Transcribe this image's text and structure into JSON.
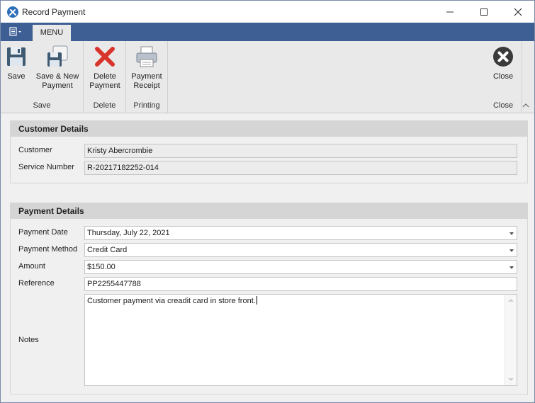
{
  "window": {
    "title": "Record Payment"
  },
  "tabs": {
    "menu": "MENU"
  },
  "ribbon": {
    "save_group": {
      "label": "Save",
      "save": "Save",
      "save_new_line1": "Save & New",
      "save_new_line2": "Payment"
    },
    "delete_group": {
      "label": "Delete",
      "delete_line1": "Delete",
      "delete_line2": "Payment"
    },
    "printing_group": {
      "label": "Printing",
      "receipt_line1": "Payment",
      "receipt_line2": "Receipt"
    },
    "close_group": {
      "label": "Close",
      "close": "Close"
    }
  },
  "customer_details": {
    "title": "Customer Details",
    "customer_label": "Customer",
    "customer_value": "Kristy Abercrombie",
    "service_label": "Service Number",
    "service_value": "R-20217182252-014"
  },
  "payment_details": {
    "title": "Payment Details",
    "date_label": "Payment Date",
    "date_value": "Thursday, July 22, 2021",
    "method_label": "Payment Method",
    "method_value": "Credit Card",
    "amount_label": "Amount",
    "amount_value": "$150.00",
    "reference_label": "Reference",
    "reference_value": "PP2255447788",
    "notes_label": "Notes",
    "notes_value": "Customer payment via creadit card in store front."
  },
  "icons": {
    "app": "tools-icon",
    "save": "floppy-disk-icon",
    "save_new": "floppy-disks-icon",
    "delete": "red-x-icon",
    "receipt": "printer-icon",
    "close": "close-circle-icon"
  },
  "colors": {
    "tabbar": "#3d5f93",
    "delete_red": "#d9342b"
  }
}
